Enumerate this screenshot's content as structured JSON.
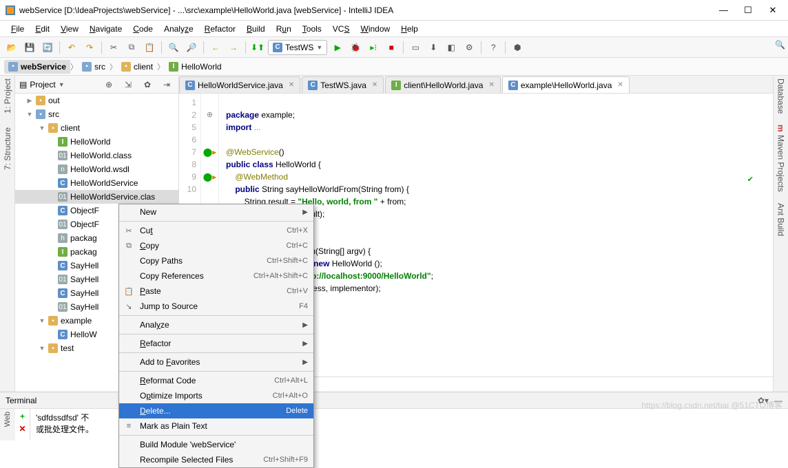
{
  "title": "webService [D:\\IdeaProjects\\webService] - ...\\src\\example\\HelloWorld.java [webService] - IntelliJ IDEA",
  "menu": [
    "File",
    "Edit",
    "View",
    "Navigate",
    "Code",
    "Analyze",
    "Refactor",
    "Build",
    "Run",
    "Tools",
    "VCS",
    "Window",
    "Help"
  ],
  "runConfig": "TestWS",
  "breadcrumb": [
    "webService",
    "src",
    "client",
    "HelloWorld"
  ],
  "projectPane": {
    "title": "Project"
  },
  "tree": {
    "out": "out",
    "src": "src",
    "client": "client",
    "items": [
      "HelloWorld",
      "HelloWorld.class",
      "HelloWorld.wsdl",
      "HelloWorldService",
      "HelloWorldService.clas",
      "ObjectF",
      "ObjectF",
      "packag",
      "packag",
      "SayHell",
      "SayHell",
      "SayHell",
      "SayHell"
    ],
    "example": "example",
    "exitems": [
      "HelloW"
    ],
    "test": "test"
  },
  "tabs": [
    {
      "label": "HelloWorldService.java",
      "active": false,
      "icon": "C"
    },
    {
      "label": "TestWS.java",
      "active": false,
      "icon": "C"
    },
    {
      "label": "client\\HelloWorld.java",
      "active": false,
      "icon": "I"
    },
    {
      "label": "example\\HelloWorld.java",
      "active": true,
      "icon": "C"
    }
  ],
  "code": {
    "lines": [
      "1",
      "2",
      "5",
      "6",
      "7",
      "8",
      "9",
      "10"
    ],
    "text": {
      "l1a": "package",
      "l1b": " example;",
      "l2a": "import",
      "l2b": " ...",
      "l4": "@WebService",
      "l4b": "()",
      "l5a": "public class",
      "l5b": " HelloWorld {",
      "l6": "@WebMethod",
      "l7a": "public",
      "l7b": " String sayHelloWorldFrom(String from) {",
      "l8a": "String result = ",
      "l8b": "\"Hello, world, from \"",
      "l8c": " + from;",
      "l9": ".println(result);",
      "l10": "ult;",
      "l12a": "c ",
      "l12b": "void",
      "l12c": " main(String[] argv) {",
      "l13a": "lementor = ",
      "l13b": "new",
      "l13c": " HelloWorld ();",
      "l14a": "ress = ",
      "l14b": "\"http://localhost:9000/HelloWorld\"",
      "l14c": ";",
      "l15": "ublish(address, implementor);"
    },
    "breadcrumb_foot": "n()"
  },
  "ctxmenu": [
    {
      "label": "New",
      "sub": true
    },
    {
      "sep": true
    },
    {
      "icon": "✂",
      "label": "Cut",
      "sc": "Ctrl+X",
      "u": 2
    },
    {
      "icon": "⧉",
      "label": "Copy",
      "sc": "Ctrl+C",
      "u": 0
    },
    {
      "label": "Copy Paths",
      "sc": "Ctrl+Shift+C"
    },
    {
      "label": "Copy References",
      "sc": "Ctrl+Alt+Shift+C"
    },
    {
      "icon": "📋",
      "label": "Paste",
      "sc": "Ctrl+V",
      "u": 0
    },
    {
      "icon": "↘",
      "label": "Jump to Source",
      "sc": "F4"
    },
    {
      "sep": true
    },
    {
      "label": "Analyze",
      "sub": true,
      "u": 4
    },
    {
      "sep": true
    },
    {
      "label": "Refactor",
      "sub": true,
      "u": 0
    },
    {
      "sep": true
    },
    {
      "label": "Add to Favorites",
      "sub": true,
      "u": 7
    },
    {
      "sep": true
    },
    {
      "label": "Reformat Code",
      "sc": "Ctrl+Alt+L",
      "u": 0
    },
    {
      "label": "Optimize Imports",
      "sc": "Ctrl+Alt+O",
      "u": 1
    },
    {
      "label": "Delete...",
      "sc": "Delete",
      "u": 0,
      "sel": true
    },
    {
      "icon": "≡",
      "label": "Mark as Plain Text"
    },
    {
      "sep": true
    },
    {
      "label": "Build Module 'webService'"
    },
    {
      "label": "Recompile Selected Files",
      "sc": "Ctrl+Shift+F9"
    }
  ],
  "terminal": {
    "title": "Terminal",
    "line1": "'sdfdssdfsd' 不",
    "line2": "或批处理文件。"
  },
  "rightTools": [
    "Database",
    "Maven Projects",
    "Ant Build"
  ],
  "leftTools": [
    "1: Project",
    "7: Structure"
  ],
  "watermark": "https://blog.csdn.net/bai @51CTO博客"
}
